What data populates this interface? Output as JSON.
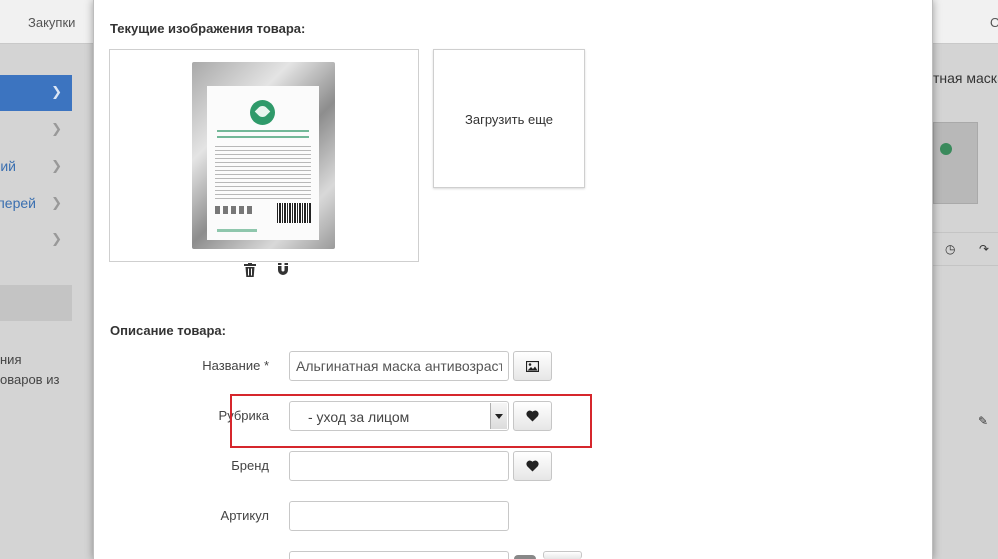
{
  "background": {
    "topbar": {
      "purchases_link": "Закупки",
      "right_partial": "О"
    },
    "sidebar": {
      "items": [
        {
          "label": "",
          "active": true
        },
        {
          "label": "",
          "active": false
        },
        {
          "label": "ий",
          "active": false
        },
        {
          "label": "лерей",
          "active": false
        },
        {
          "label": "",
          "active": false
        }
      ],
      "text_line1": "ния",
      "text_line2": "оваров из"
    },
    "right_panel": {
      "title_partial": "тная маска"
    }
  },
  "modal": {
    "images_title": "Текущие изображения товара:",
    "upload_more_label": "Загрузить еще",
    "description_title": "Описание товара:",
    "fields": {
      "name_label": "Название *",
      "name_value": "Альгинатная маска антивозраст",
      "category_label": "Рубрика",
      "category_value": "- уход за лицом",
      "brand_label": "Бренд",
      "brand_value": "",
      "sku_label": "Артикул",
      "sku_value": ""
    }
  },
  "colors": {
    "highlight_border": "#d6262c",
    "active_nav": "#3c74c0",
    "product_logo": "#2f9a6a"
  }
}
